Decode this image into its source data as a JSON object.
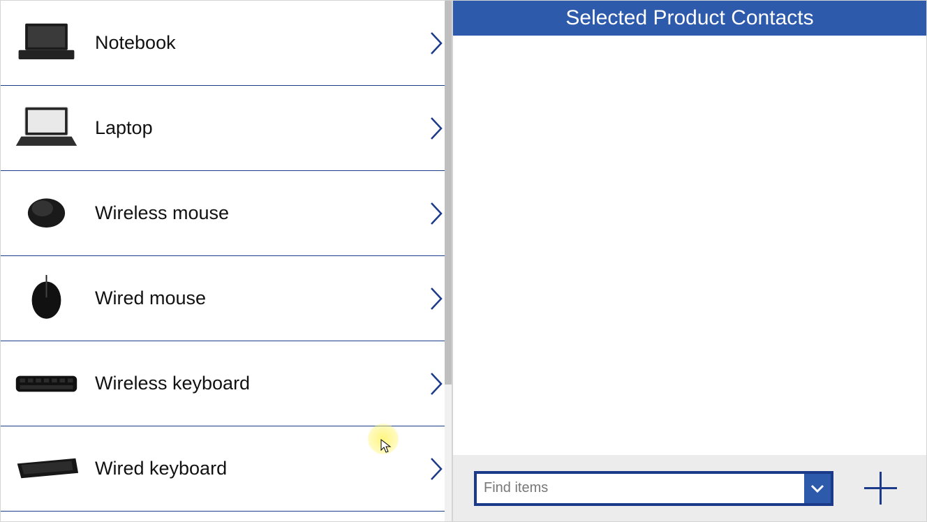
{
  "products": [
    {
      "label": "Notebook",
      "icon": "notebook"
    },
    {
      "label": "Laptop",
      "icon": "laptop"
    },
    {
      "label": "Wireless mouse",
      "icon": "wireless-mouse"
    },
    {
      "label": "Wired mouse",
      "icon": "wired-mouse"
    },
    {
      "label": "Wireless keyboard",
      "icon": "wireless-keyboard"
    },
    {
      "label": "Wired keyboard",
      "icon": "wired-keyboard"
    }
  ],
  "right": {
    "header": "Selected Product Contacts",
    "find_placeholder": "Find items"
  }
}
